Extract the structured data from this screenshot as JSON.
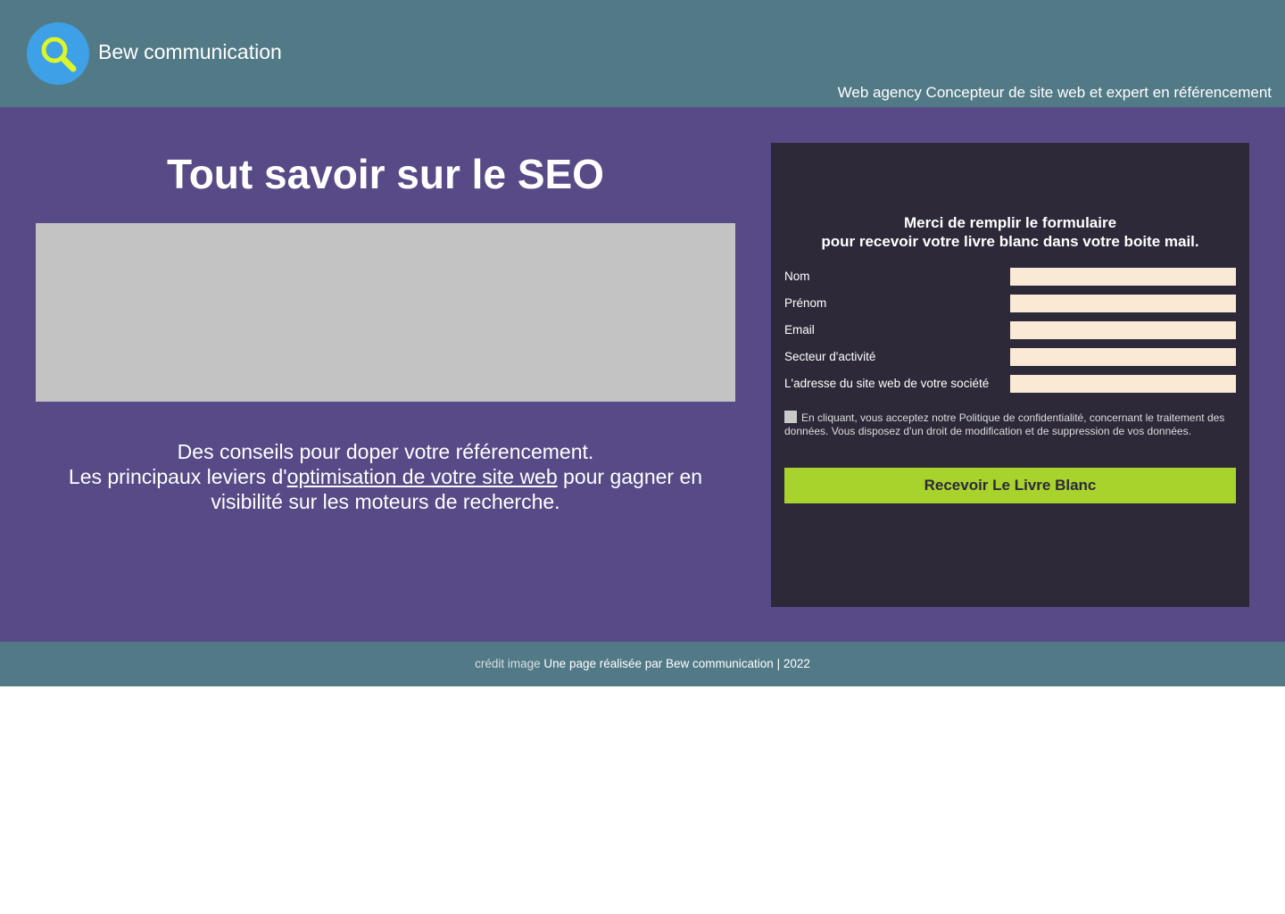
{
  "header": {
    "brand": "Bew communication",
    "tagline": "Web agency Concepteur de site web et expert en référencement",
    "logo_icon": "search-icon"
  },
  "main": {
    "title": "Tout savoir sur le SEO",
    "intro_line1": "Des conseils pour doper votre référencement.",
    "intro_line2_before": "Les principaux leviers d'",
    "intro_link": "optimisation de votre site web",
    "intro_line2_after": " pour gagner en",
    "intro_line3": "visibilité sur les moteurs de recherche."
  },
  "form": {
    "heading_line1": "Merci de remplir le formulaire",
    "heading_line2": "pour recevoir votre livre blanc dans votre boite mail.",
    "fields": [
      {
        "label": "Nom",
        "value": ""
      },
      {
        "label": "Prénom",
        "value": ""
      },
      {
        "label": "Email",
        "value": ""
      },
      {
        "label": "Secteur d'activité",
        "value": ""
      },
      {
        "label": "L'adresse du site web de votre société",
        "value": ""
      }
    ],
    "consent_text": "En cliquant, vous acceptez notre Politique de confidentialité, concernant le traitement des données. Vous disposez d'un droit de modification et de suppression de vos données.",
    "submit_label": "Recevoir Le Livre Blanc"
  },
  "footer": {
    "credit": "crédit image",
    "text": " Une page réalisée par Bew communication | 2022"
  },
  "colors": {
    "header_bg": "#527a86",
    "main_bg": "#574a86",
    "form_bg": "#2d2939",
    "input_bg": "#fae9d5",
    "button_bg": "#a8d22c",
    "logo_bg": "#3ea0e6",
    "logo_glass": "#dcf52a"
  }
}
